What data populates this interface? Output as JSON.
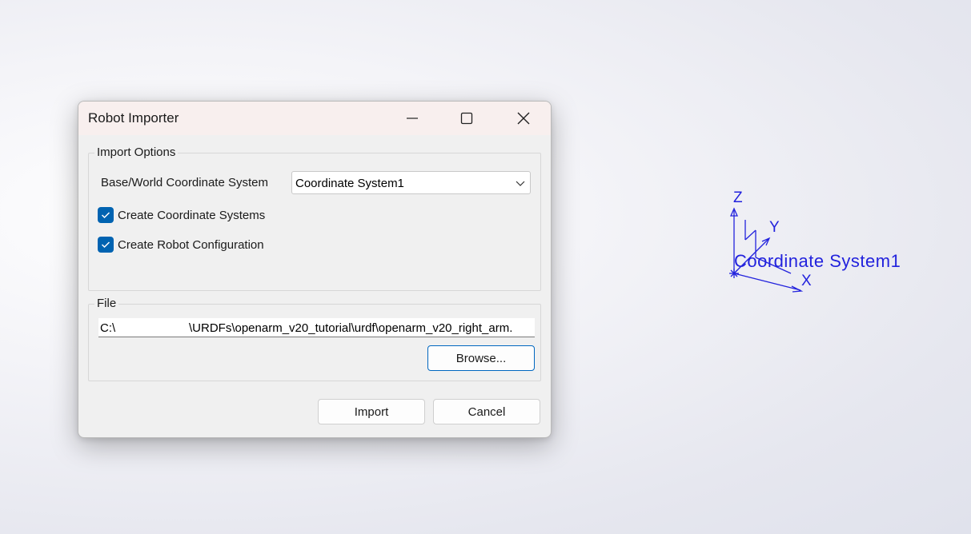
{
  "dialog": {
    "title": "Robot Importer",
    "import_options": {
      "legend": "Import Options",
      "base_label": "Base/World Coordinate System",
      "base_value": "Coordinate System1",
      "create_cs_label": "Create Coordinate Systems",
      "create_cs_checked": true,
      "create_config_label": "Create Robot Configuration",
      "create_config_checked": true
    },
    "file": {
      "legend": "File",
      "drive": "C:\\",
      "path": "\\URDFs\\openarm_v20_tutorial\\urdf\\openarm_v20_right_arm.",
      "browse_label": "Browse..."
    },
    "import_label": "Import",
    "cancel_label": "Cancel"
  },
  "viewport": {
    "triad": {
      "z_label": "Z",
      "y_label": "Y",
      "x_label": "X",
      "name": "Coordinate System1",
      "color": "#2222dd"
    }
  },
  "colors": {
    "accent": "#0063b1",
    "titlebar": "#f8efee",
    "dialog_bg": "#f0f0f0"
  }
}
